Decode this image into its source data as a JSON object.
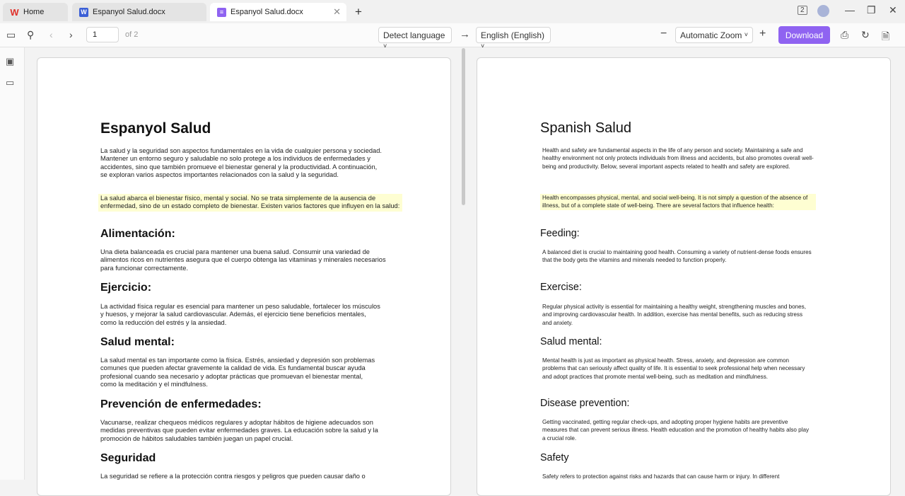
{
  "tabs": {
    "home": "Home",
    "tab1": "Espanyol Salud.docx",
    "tab2": "Espanyol Salud.docx"
  },
  "toolbar": {
    "page_number": "1",
    "page_total": "of 2",
    "source_language": "Detect language",
    "target_language": "English (English)",
    "zoom": "Automatic Zoom",
    "download_label": "Download"
  },
  "colors": {
    "accent": "#8f63f1",
    "highlight": "#fefed2"
  },
  "left_doc": {
    "title": "Espanyol Salud",
    "intro": "La salud y la seguridad son aspectos fundamentales en la vida de cualquier persona y sociedad. Mantener un entorno seguro y saludable no solo protege a los individuos de enfermedades y accidentes, sino que también promueve el bienestar general y la productividad. A continuación, se exploran varios aspectos importantes relacionados con la salud y la seguridad.",
    "highlight": "La salud abarca el bienestar físico, mental y social. No se trata simplemente de la ausencia de enfermedad, sino de un estado completo de bienestar. Existen varios factores que influyen en la salud:",
    "h_food": "Alimentación:",
    "p_food": "Una dieta balanceada es crucial para mantener una buena salud. Consumir una variedad de alimentos ricos en nutrientes asegura que el cuerpo obtenga las vitaminas y minerales necesarios para funcionar correctamente.",
    "h_exercise": "Ejercicio:",
    "p_exercise": "La actividad física regular es esencial para mantener un peso saludable, fortalecer los músculos y huesos, y mejorar la salud cardiovascular. Además, el ejercicio tiene beneficios mentales, como la reducción del estrés y la ansiedad.",
    "h_mental": "Salud mental:",
    "p_mental": "La salud mental es tan importante como la física. Estrés, ansiedad y depresión son problemas comunes que pueden afectar gravemente la calidad de vida. Es fundamental buscar ayuda profesional cuando sea necesario y adoptar prácticas que promuevan el bienestar mental, como la meditación y el mindfulness.",
    "h_prevention": "Prevención de enfermedades:",
    "p_prevention": "Vacunarse, realizar chequeos médicos regulares y adoptar hábitos de higiene adecuados son medidas preventivas que pueden evitar enfermedades graves. La educación sobre la salud y la promoción de hábitos saludables también juegan un papel crucial.",
    "h_safety": "Seguridad",
    "p_safety": "La seguridad se refiere a la protección contra riesgos y peligros que pueden causar daño o"
  },
  "right_doc": {
    "title": "Spanish Salud",
    "intro": "Health and safety are fundamental aspects in the life of any person and society. Maintaining a safe and healthy environment not only protects individuals from illness and accidents, but also promotes overall well-being and productivity. Below, several important aspects related to health and safety are explored.",
    "highlight": "Health encompasses physical, mental, and social well-being. It is not simply a question of the absence of illness, but of a complete state of well-being. There are several factors that influence health:",
    "h_food": "Feeding:",
    "p_food": "A balanced diet is crucial to maintaining good health. Consuming a variety of nutrient-dense foods ensures that the body gets the vitamins and minerals needed to function properly.",
    "h_exercise": "Exercise:",
    "p_exercise": "Regular physical activity is essential for maintaining a healthy weight, strengthening muscles and bones, and improving cardiovascular health. In addition, exercise has mental benefits, such as reducing stress and anxiety.",
    "h_mental": "Salud mental:",
    "p_mental": "Mental health is just as important as physical health. Stress, anxiety, and depression are common problems that can seriously affect quality of life. It is essential to seek professional help when necessary and adopt practices that promote mental well-being, such as meditation and mindfulness.",
    "h_prevention": "Disease prevention:",
    "p_prevention": "Getting vaccinated, getting regular check-ups, and adopting proper hygiene habits are preventive measures that can prevent serious illness. Health education and the promotion of healthy habits also play a crucial role.",
    "h_safety": "Safety",
    "p_safety": "Safety refers to protection against risks and hazards that can cause harm or injury. In different"
  }
}
